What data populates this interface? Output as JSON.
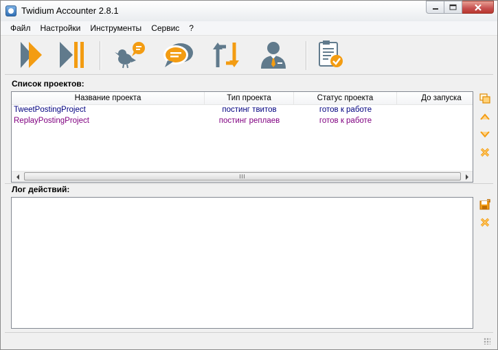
{
  "window": {
    "title": "Twidium Accounter 2.8.1"
  },
  "menu": [
    "Файл",
    "Настройки",
    "Инструменты",
    "Сервис",
    "?"
  ],
  "toolbar": {
    "buttons": [
      "start-all-icon",
      "pause-icon",
      "twitter-bird-icon",
      "chat-bubbles-icon",
      "retweet-icon",
      "user-icon",
      "task-checklist-icon"
    ],
    "accent": "#f39c12",
    "icon_gray": "#607a8c"
  },
  "projects": {
    "label": "Список проектов:",
    "columns": [
      "Название проекта",
      "Тип проекта",
      "Статус проекта",
      "До запуска"
    ],
    "rows": [
      {
        "name": "TweetPostingProject",
        "type": "постинг твитов",
        "status": "готов к работе",
        "until": "",
        "color": "#000080"
      },
      {
        "name": "ReplayPostingProject",
        "type": "постинг реплаев",
        "status": "готов к работе",
        "until": "",
        "color": "#800080"
      }
    ]
  },
  "log": {
    "label": "Лог действий:"
  }
}
